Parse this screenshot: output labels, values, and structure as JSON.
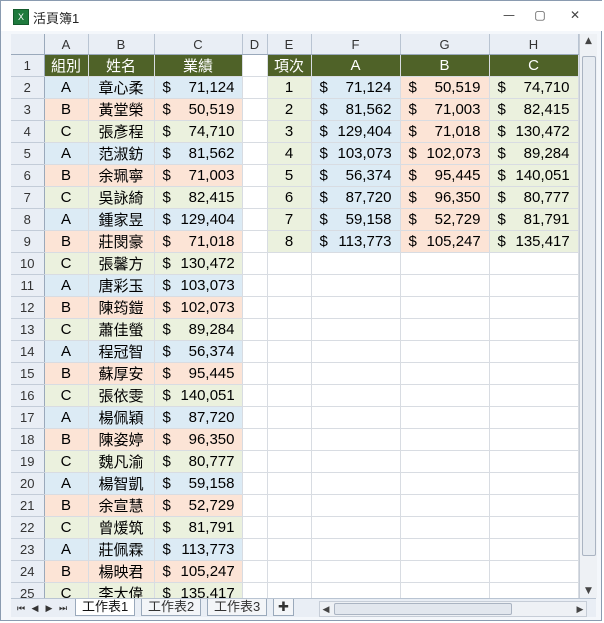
{
  "window": {
    "title": "活頁簿1",
    "icon_name": "excel-workbook-icon",
    "buttons": {
      "minimize": "—",
      "restore": "▢",
      "close": "✕"
    }
  },
  "columns": [
    "A",
    "B",
    "C",
    "D",
    "E",
    "F",
    "G",
    "H"
  ],
  "header_row": {
    "group": "組別",
    "name": "姓名",
    "sales": "業績",
    "item": "項次",
    "A": "A",
    "B": "B",
    "C": "C"
  },
  "rows": [
    {
      "group": "A",
      "name": "章心柔",
      "amt": "71,124"
    },
    {
      "group": "B",
      "name": "黃堂榮",
      "amt": "50,519"
    },
    {
      "group": "C",
      "name": "張彥程",
      "amt": "74,710"
    },
    {
      "group": "A",
      "name": "范淑鈁",
      "amt": "81,562"
    },
    {
      "group": "B",
      "name": "余珮寧",
      "amt": "71,003"
    },
    {
      "group": "C",
      "name": "吳詠綺",
      "amt": "82,415"
    },
    {
      "group": "A",
      "name": "鍾家昱",
      "amt": "129,404"
    },
    {
      "group": "B",
      "name": "莊閔豪",
      "amt": "71,018"
    },
    {
      "group": "C",
      "name": "張馨方",
      "amt": "130,472"
    },
    {
      "group": "A",
      "name": "唐彩玉",
      "amt": "103,073"
    },
    {
      "group": "B",
      "name": "陳筠鎧",
      "amt": "102,073"
    },
    {
      "group": "C",
      "name": "蕭佳螢",
      "amt": "89,284"
    },
    {
      "group": "A",
      "name": "程冠智",
      "amt": "56,374"
    },
    {
      "group": "B",
      "name": "蘇厚安",
      "amt": "95,445"
    },
    {
      "group": "C",
      "name": "張依雯",
      "amt": "140,051"
    },
    {
      "group": "A",
      "name": "楊佩穎",
      "amt": "87,720"
    },
    {
      "group": "B",
      "name": "陳姿婷",
      "amt": "96,350"
    },
    {
      "group": "C",
      "name": "魏凡渝",
      "amt": "80,777"
    },
    {
      "group": "A",
      "name": "楊智凱",
      "amt": "59,158"
    },
    {
      "group": "B",
      "name": "余宣慧",
      "amt": "52,729"
    },
    {
      "group": "C",
      "name": "曾煖筑",
      "amt": "81,791"
    },
    {
      "group": "A",
      "name": "莊佩霖",
      "amt": "113,773"
    },
    {
      "group": "B",
      "name": "楊映君",
      "amt": "105,247"
    },
    {
      "group": "C",
      "name": "李大偉",
      "amt": "135,417"
    }
  ],
  "summary": [
    {
      "item": "1",
      "A": "71,124",
      "B": "50,519",
      "C": "74,710"
    },
    {
      "item": "2",
      "A": "81,562",
      "B": "71,003",
      "C": "82,415"
    },
    {
      "item": "3",
      "A": "129,404",
      "B": "71,018",
      "C": "130,472"
    },
    {
      "item": "4",
      "A": "103,073",
      "B": "102,073",
      "C": "89,284"
    },
    {
      "item": "5",
      "A": "56,374",
      "B": "95,445",
      "C": "140,051"
    },
    {
      "item": "6",
      "A": "87,720",
      "B": "96,350",
      "C": "80,777"
    },
    {
      "item": "7",
      "A": "59,158",
      "B": "52,729",
      "C": "81,791"
    },
    {
      "item": "8",
      "A": "113,773",
      "B": "105,247",
      "C": "135,417"
    }
  ],
  "currency": "$",
  "tabs": [
    "工作表1",
    "工作表2",
    "工作表3"
  ],
  "active_tab": "工作表1",
  "colors": {
    "header_bg": "#4f6228",
    "group_a_bg": "#dcebf5",
    "group_b_bg": "#fce4d6",
    "group_c_bg": "#ebf1de"
  }
}
